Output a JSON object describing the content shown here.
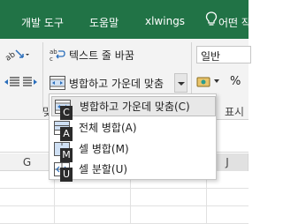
{
  "tabs": [
    {
      "label": "개발 도구"
    },
    {
      "label": "도움말"
    },
    {
      "label": "xlwings"
    },
    {
      "label": "어떤 작"
    }
  ],
  "ribbon": {
    "wrap_text_label": "텍스트 줄 바꿈",
    "merge_center_label": "병합하고 가운데 맞춤",
    "number_format_value": "일반",
    "percent_symbol": "%",
    "group_label_left": "맞",
    "group_label_right": "표시 "
  },
  "merge_menu": {
    "items": [
      {
        "label": "병합하고 가운데 맞춤(C)",
        "keytip": "C",
        "selected": true
      },
      {
        "label": "전체 병합(A)",
        "keytip": "A",
        "selected": false
      },
      {
        "label": "셀 병합(M)",
        "keytip": "M",
        "selected": false
      },
      {
        "label": "셀 분할(U)",
        "keytip": "U",
        "selected": false
      }
    ]
  },
  "columns": [
    "G",
    "H",
    "I",
    "J"
  ],
  "colors": {
    "excel_green": "#217346",
    "ribbon_bg": "#f3f3f3",
    "selected_item_bg": "#e8e8e8",
    "keytip_bg": "#2b2b2b"
  }
}
